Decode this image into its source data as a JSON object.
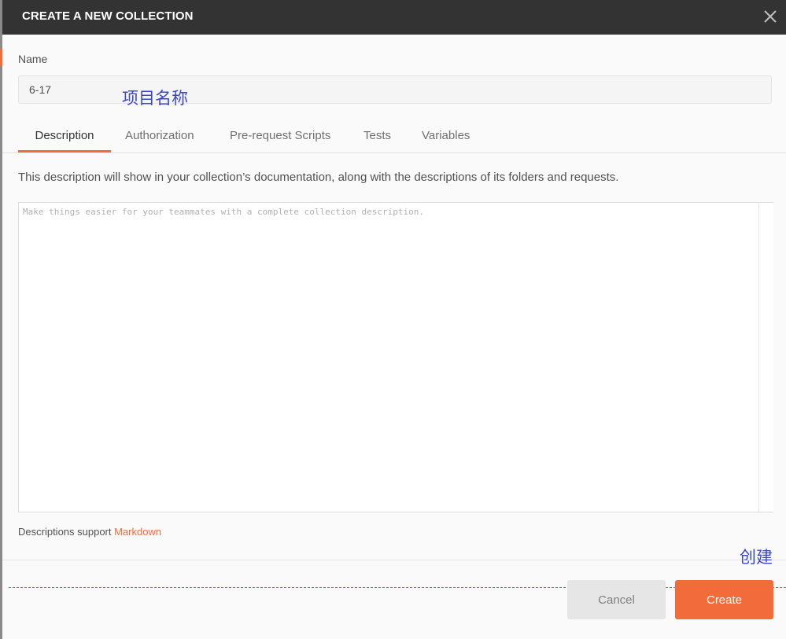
{
  "dialog": {
    "title": "CREATE A NEW COLLECTION",
    "close_icon": "close-x-icon"
  },
  "name_field": {
    "label": "Name",
    "value": "6-17"
  },
  "tabs": [
    {
      "label": "Description",
      "active": true
    },
    {
      "label": "Authorization",
      "active": false
    },
    {
      "label": "Pre-request Scripts",
      "active": false
    },
    {
      "label": "Tests",
      "active": false
    },
    {
      "label": "Variables",
      "active": false
    }
  ],
  "description": {
    "help_text": "This description will show in your collection’s documentation, along with the descriptions of its folders and requests.",
    "placeholder": "Make things easier for your teammates with a complete collection description.",
    "value": "",
    "markdown_prefix": "Descriptions support ",
    "markdown_link": "Markdown"
  },
  "annotations": {
    "name_note": "项目名称",
    "create_note": "创建"
  },
  "footer": {
    "cancel_label": "Cancel",
    "create_label": "Create"
  },
  "colors": {
    "header_bg": "#333333",
    "accent": "#f26b3a",
    "annotation": "#3a48c8",
    "guide_line": "#2f8fd0"
  }
}
